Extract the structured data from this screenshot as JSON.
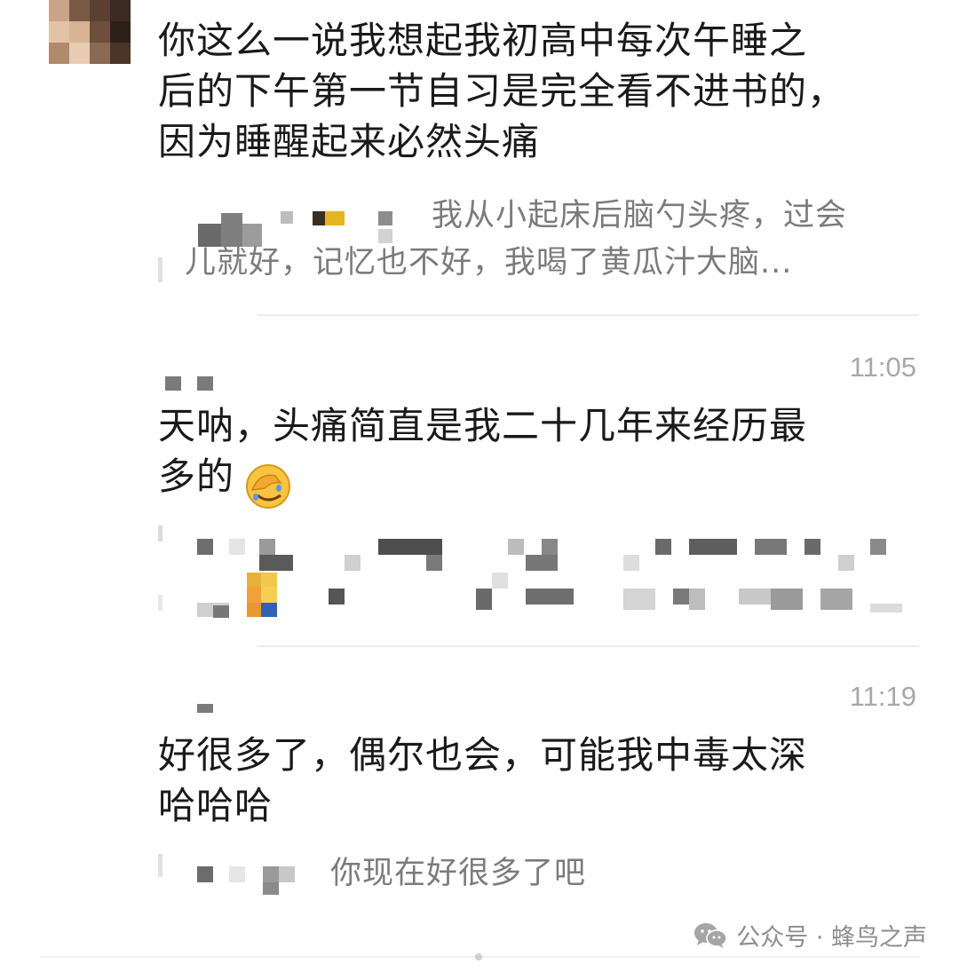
{
  "messages": [
    {
      "text": "你这么一说我想起我初高中每次午睡之\n后的下午第一节自习是完全看不进书的，\n因为睡醒起来必然头痛"
    },
    {
      "time": "11:05",
      "text": "天呐，头痛简直是我二十几年来经历最\n多的"
    },
    {
      "time": "11:19",
      "text": "好很多了，偶尔也会，可能我中毒太深\n哈哈哈"
    }
  ],
  "quotes": [
    {
      "line1": "我从小起床后脑勺头疼，过会",
      "line2": "儿就好，记忆也不好，我喝了黄瓜汁大脑..."
    },
    {
      "line1": "你现在好很多了吧"
    }
  ],
  "watermark": {
    "label": "公众号 · 蜂鸟之声",
    "icon": "wechat-icon"
  },
  "emoji": {
    "name": "facepalm-laugh-icon"
  },
  "colors": {
    "text": "#1a1a1a",
    "quote_text": "#7b7b7b",
    "time": "#a8a8a8",
    "divider": "#ececec",
    "mosaic_dark": "#555555",
    "mosaic_mid": "#9a9a9a",
    "mosaic_light": "#d8d8d8"
  }
}
